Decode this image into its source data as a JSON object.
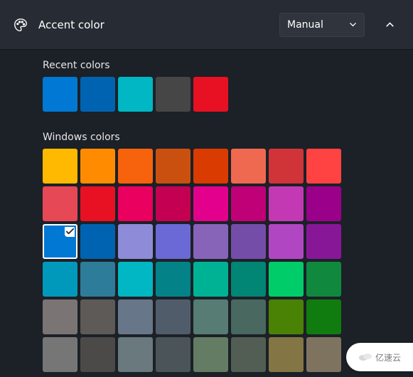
{
  "header": {
    "title": "Accent color",
    "mode_selected": "Manual",
    "icon": "palette-icon"
  },
  "sections": {
    "recent_label": "Recent colors",
    "windows_label": "Windows colors"
  },
  "recent_colors": [
    "#0078D4",
    "#0063B1",
    "#00B7C3",
    "#464646",
    "#E81123"
  ],
  "windows_colors": [
    "#FFB900",
    "#FF8C00",
    "#F7630C",
    "#CA5010",
    "#DA3B01",
    "#EF6950",
    "#D13438",
    "#FF4343",
    "#E74856",
    "#E81123",
    "#EA005E",
    "#C30052",
    "#E3008C",
    "#BF0077",
    "#C239B3",
    "#9A0089",
    "#0078D4",
    "#0063B1",
    "#8E8CD8",
    "#6B69D6",
    "#8764B8",
    "#744DA9",
    "#B146C2",
    "#881798",
    "#0099BC",
    "#2D7D9A",
    "#00B7C3",
    "#038387",
    "#00B294",
    "#018574",
    "#00CC6A",
    "#10893E",
    "#7A7574",
    "#5D5A58",
    "#68768A",
    "#515C6B",
    "#567C73",
    "#486860",
    "#498205",
    "#107C10",
    "#767676",
    "#4C4A48",
    "#69797E",
    "#4A5459",
    "#647C64",
    "#525E54",
    "#847545",
    "#7E735F"
  ],
  "selected_index": 16,
  "watermark": "亿速云"
}
